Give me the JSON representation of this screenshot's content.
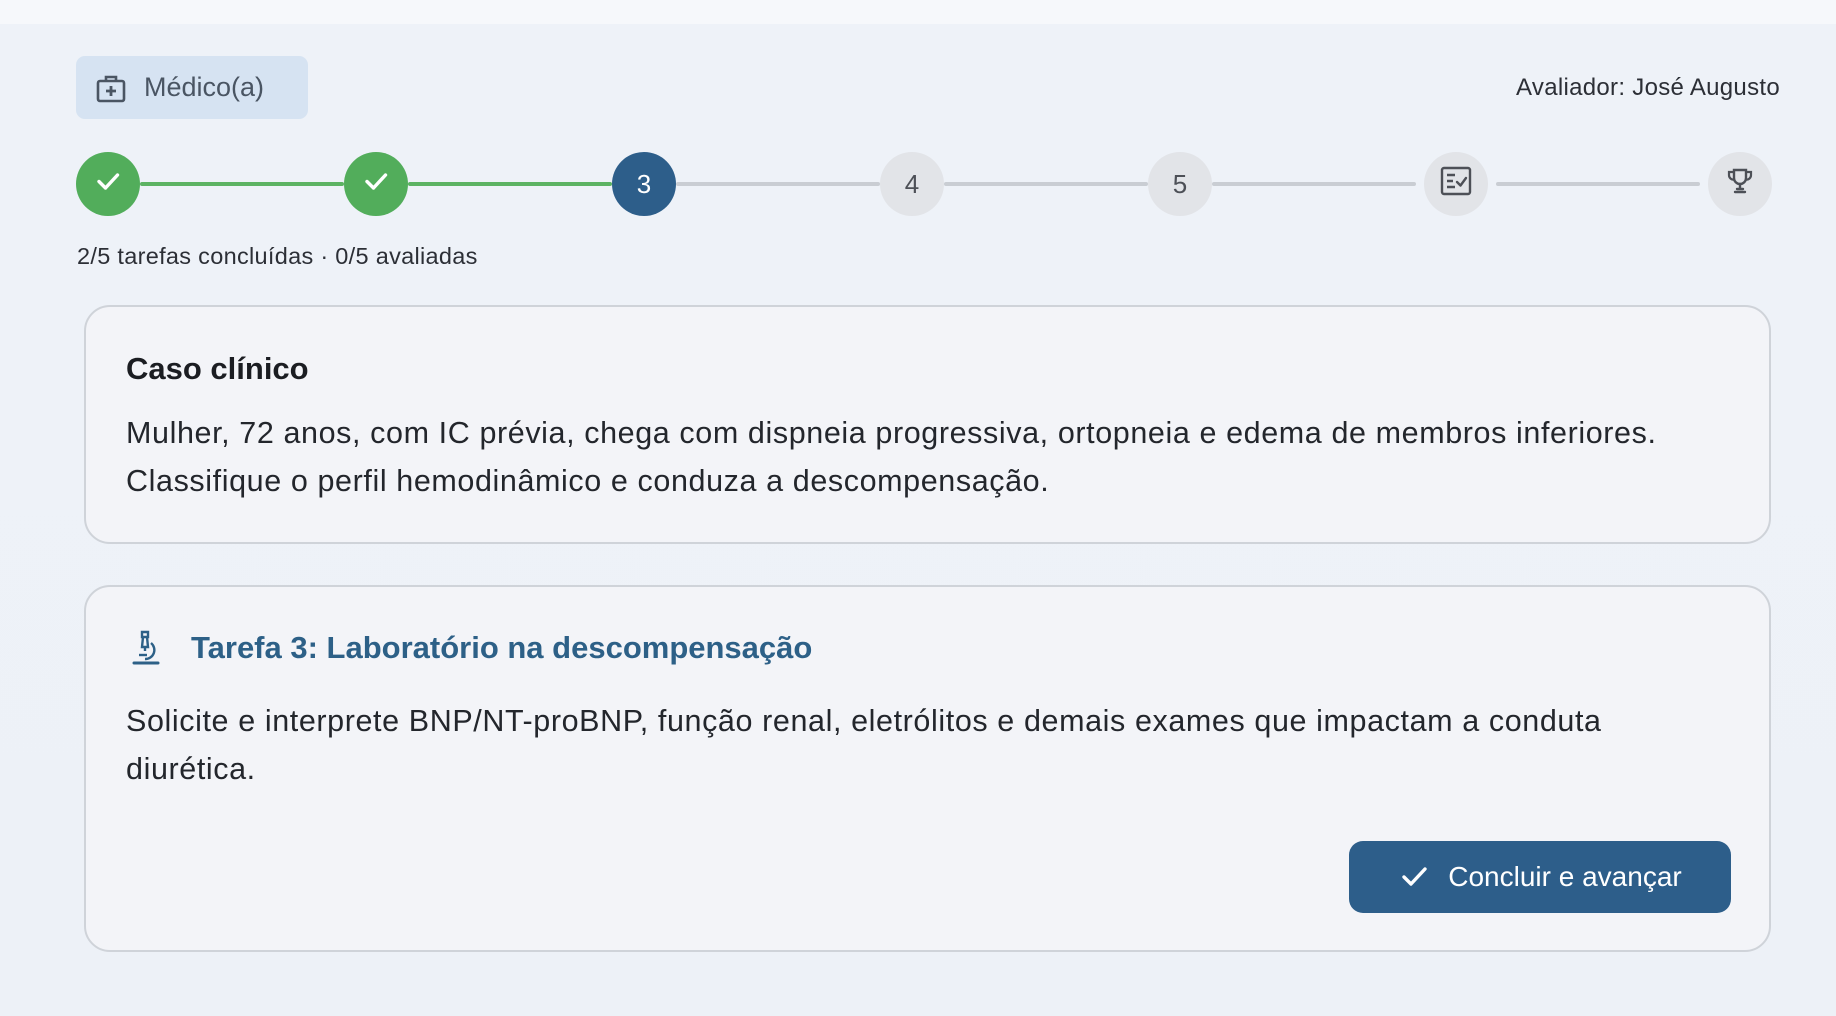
{
  "header": {
    "role_label": "Médico(a)",
    "role_icon": "medical-bag-icon",
    "evaluator": "Avaliador: José Augusto"
  },
  "stepper": {
    "steps": [
      {
        "label": "",
        "status": "done",
        "icon": "check-icon"
      },
      {
        "label": "",
        "status": "done",
        "icon": "check-icon"
      },
      {
        "label": "3",
        "status": "current"
      },
      {
        "label": "4",
        "status": "pending"
      },
      {
        "label": "5",
        "status": "pending"
      },
      {
        "label": "",
        "status": "pending",
        "icon": "checklist-icon"
      },
      {
        "label": "",
        "status": "pending",
        "icon": "trophy-icon"
      }
    ],
    "progress_text": "2/5 tarefas concluídas · 0/5 avaliadas"
  },
  "case": {
    "title": "Caso clínico",
    "body": "Mulher, 72 anos, com IC prévia, chega com dispneia progressiva, ortopneia e edema de membros inferiores. Classifique o perfil hemodinâmico e conduza a descompensação."
  },
  "task": {
    "icon": "microscope-icon",
    "title": "Tarefa 3: Laboratório na descompensação",
    "body": "Solicite e interprete BNP/NT-proBNP, função renal, eletrólitos e demais exames que impactam a conduta diurética.",
    "button_label": "Concluir e avançar",
    "button_icon": "check-icon"
  },
  "colors": {
    "accent": "#2d5e8a",
    "done": "#52ad5b",
    "pending": "#e2e4e8",
    "chip_bg": "#d6e3f2"
  }
}
